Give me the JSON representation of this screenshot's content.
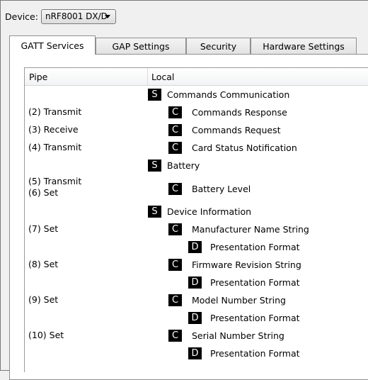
{
  "device": {
    "label": "Device:",
    "value": "nRF8001 DX/D"
  },
  "tabs": [
    {
      "label": "GATT Services",
      "active": true
    },
    {
      "label": "GAP Settings",
      "active": false
    },
    {
      "label": "Security",
      "active": false
    },
    {
      "label": "Hardware Settings",
      "active": false
    }
  ],
  "list": {
    "headers": {
      "pipe": "Pipe",
      "local": "Local"
    },
    "rows": [
      {
        "pipe": "",
        "type": "S",
        "label": "Commands Communication"
      },
      {
        "pipe": "(2) Transmit",
        "type": "C",
        "label": "Commands Response"
      },
      {
        "pipe": "(3) Receive",
        "type": "C",
        "label": "Commands Request"
      },
      {
        "pipe": "(4) Transmit",
        "type": "C",
        "label": "Card Status Notification"
      },
      {
        "pipe": "",
        "type": "S",
        "label": "Battery"
      },
      {
        "pipe": "(5) Transmit\n(6) Set",
        "type": "C",
        "label": "Battery Level"
      },
      {
        "pipe": "",
        "type": "S",
        "label": "Device Information"
      },
      {
        "pipe": "(7) Set",
        "type": "C",
        "label": "Manufacturer Name String"
      },
      {
        "pipe": "",
        "type": "D",
        "label": "Presentation Format"
      },
      {
        "pipe": "(8) Set",
        "type": "C",
        "label": "Firmware Revision String"
      },
      {
        "pipe": "",
        "type": "D",
        "label": "Presentation Format"
      },
      {
        "pipe": "(9) Set",
        "type": "C",
        "label": "Model Number String"
      },
      {
        "pipe": "",
        "type": "D",
        "label": "Presentation Format"
      },
      {
        "pipe": "(10) Set",
        "type": "C",
        "label": "Serial Number String"
      },
      {
        "pipe": "",
        "type": "D",
        "label": "Presentation Format"
      }
    ]
  }
}
